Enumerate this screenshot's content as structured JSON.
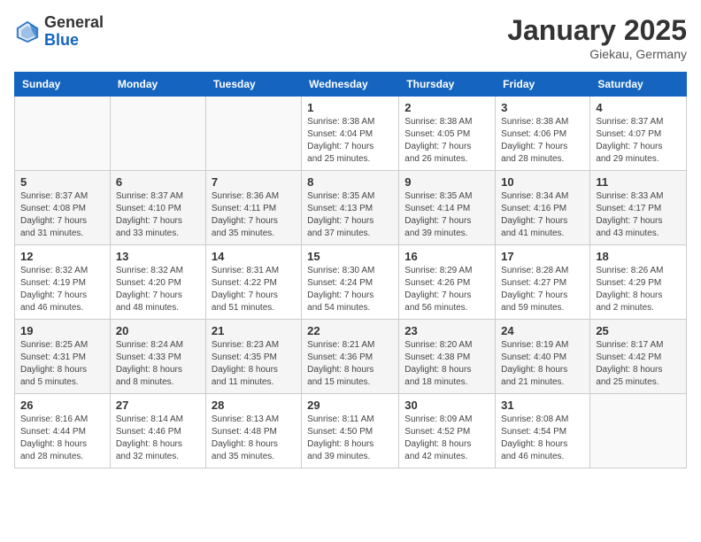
{
  "header": {
    "logo_general": "General",
    "logo_blue": "Blue",
    "month_title": "January 2025",
    "location": "Giekau, Germany"
  },
  "weekdays": [
    "Sunday",
    "Monday",
    "Tuesday",
    "Wednesday",
    "Thursday",
    "Friday",
    "Saturday"
  ],
  "weeks": [
    [
      {
        "day": "",
        "info": ""
      },
      {
        "day": "",
        "info": ""
      },
      {
        "day": "",
        "info": ""
      },
      {
        "day": "1",
        "info": "Sunrise: 8:38 AM\nSunset: 4:04 PM\nDaylight: 7 hours\nand 25 minutes."
      },
      {
        "day": "2",
        "info": "Sunrise: 8:38 AM\nSunset: 4:05 PM\nDaylight: 7 hours\nand 26 minutes."
      },
      {
        "day": "3",
        "info": "Sunrise: 8:38 AM\nSunset: 4:06 PM\nDaylight: 7 hours\nand 28 minutes."
      },
      {
        "day": "4",
        "info": "Sunrise: 8:37 AM\nSunset: 4:07 PM\nDaylight: 7 hours\nand 29 minutes."
      }
    ],
    [
      {
        "day": "5",
        "info": "Sunrise: 8:37 AM\nSunset: 4:08 PM\nDaylight: 7 hours\nand 31 minutes."
      },
      {
        "day": "6",
        "info": "Sunrise: 8:37 AM\nSunset: 4:10 PM\nDaylight: 7 hours\nand 33 minutes."
      },
      {
        "day": "7",
        "info": "Sunrise: 8:36 AM\nSunset: 4:11 PM\nDaylight: 7 hours\nand 35 minutes."
      },
      {
        "day": "8",
        "info": "Sunrise: 8:35 AM\nSunset: 4:13 PM\nDaylight: 7 hours\nand 37 minutes."
      },
      {
        "day": "9",
        "info": "Sunrise: 8:35 AM\nSunset: 4:14 PM\nDaylight: 7 hours\nand 39 minutes."
      },
      {
        "day": "10",
        "info": "Sunrise: 8:34 AM\nSunset: 4:16 PM\nDaylight: 7 hours\nand 41 minutes."
      },
      {
        "day": "11",
        "info": "Sunrise: 8:33 AM\nSunset: 4:17 PM\nDaylight: 7 hours\nand 43 minutes."
      }
    ],
    [
      {
        "day": "12",
        "info": "Sunrise: 8:32 AM\nSunset: 4:19 PM\nDaylight: 7 hours\nand 46 minutes."
      },
      {
        "day": "13",
        "info": "Sunrise: 8:32 AM\nSunset: 4:20 PM\nDaylight: 7 hours\nand 48 minutes."
      },
      {
        "day": "14",
        "info": "Sunrise: 8:31 AM\nSunset: 4:22 PM\nDaylight: 7 hours\nand 51 minutes."
      },
      {
        "day": "15",
        "info": "Sunrise: 8:30 AM\nSunset: 4:24 PM\nDaylight: 7 hours\nand 54 minutes."
      },
      {
        "day": "16",
        "info": "Sunrise: 8:29 AM\nSunset: 4:26 PM\nDaylight: 7 hours\nand 56 minutes."
      },
      {
        "day": "17",
        "info": "Sunrise: 8:28 AM\nSunset: 4:27 PM\nDaylight: 7 hours\nand 59 minutes."
      },
      {
        "day": "18",
        "info": "Sunrise: 8:26 AM\nSunset: 4:29 PM\nDaylight: 8 hours\nand 2 minutes."
      }
    ],
    [
      {
        "day": "19",
        "info": "Sunrise: 8:25 AM\nSunset: 4:31 PM\nDaylight: 8 hours\nand 5 minutes."
      },
      {
        "day": "20",
        "info": "Sunrise: 8:24 AM\nSunset: 4:33 PM\nDaylight: 8 hours\nand 8 minutes."
      },
      {
        "day": "21",
        "info": "Sunrise: 8:23 AM\nSunset: 4:35 PM\nDaylight: 8 hours\nand 11 minutes."
      },
      {
        "day": "22",
        "info": "Sunrise: 8:21 AM\nSunset: 4:36 PM\nDaylight: 8 hours\nand 15 minutes."
      },
      {
        "day": "23",
        "info": "Sunrise: 8:20 AM\nSunset: 4:38 PM\nDaylight: 8 hours\nand 18 minutes."
      },
      {
        "day": "24",
        "info": "Sunrise: 8:19 AM\nSunset: 4:40 PM\nDaylight: 8 hours\nand 21 minutes."
      },
      {
        "day": "25",
        "info": "Sunrise: 8:17 AM\nSunset: 4:42 PM\nDaylight: 8 hours\nand 25 minutes."
      }
    ],
    [
      {
        "day": "26",
        "info": "Sunrise: 8:16 AM\nSunset: 4:44 PM\nDaylight: 8 hours\nand 28 minutes."
      },
      {
        "day": "27",
        "info": "Sunrise: 8:14 AM\nSunset: 4:46 PM\nDaylight: 8 hours\nand 32 minutes."
      },
      {
        "day": "28",
        "info": "Sunrise: 8:13 AM\nSunset: 4:48 PM\nDaylight: 8 hours\nand 35 minutes."
      },
      {
        "day": "29",
        "info": "Sunrise: 8:11 AM\nSunset: 4:50 PM\nDaylight: 8 hours\nand 39 minutes."
      },
      {
        "day": "30",
        "info": "Sunrise: 8:09 AM\nSunset: 4:52 PM\nDaylight: 8 hours\nand 42 minutes."
      },
      {
        "day": "31",
        "info": "Sunrise: 8:08 AM\nSunset: 4:54 PM\nDaylight: 8 hours\nand 46 minutes."
      },
      {
        "day": "",
        "info": ""
      }
    ]
  ]
}
